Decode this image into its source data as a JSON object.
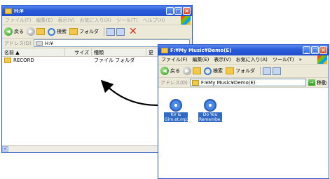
{
  "back_window": {
    "title": "H:¥",
    "menu": [
      "ファイル(F)",
      "編集(E)",
      "表示(V)",
      "お気に入り(A)",
      "ツール(T)",
      "ヘルプ(H)"
    ],
    "toolbar": {
      "back": "戻る",
      "search": "検索",
      "folders": "フォルダ"
    },
    "address_label": "アドレス(D)",
    "address_value": "H:¥",
    "columns": [
      "名前 ▲",
      "サイズ",
      "種類",
      "更"
    ],
    "rows": [
      {
        "name": "RECORD",
        "size": "",
        "type": "ファイル フォルダ"
      }
    ],
    "scroll_left": "<"
  },
  "front_window": {
    "title": "F:¥My Music¥Demo(E)",
    "menu": [
      "ファイル(F)",
      "編集(E)",
      "表示(V)",
      "お気に入り(A)",
      "ツール(T)"
    ],
    "menu_more": "»",
    "toolbar": {
      "back": "戻る",
      "search": "検索",
      "folders": "フォルダ"
    },
    "address_label": "アドレス(D)",
    "address_value": "F:¥My Music¥Demo(E)",
    "go_label": "移動",
    "files": [
      {
        "label": "Kir & Gim.et.mp3"
      },
      {
        "label": "Do You Remembe.."
      }
    ]
  },
  "colors": {
    "titlebar": "#2a5ad8",
    "selection": "#316ac5",
    "arrow": "#000000"
  }
}
